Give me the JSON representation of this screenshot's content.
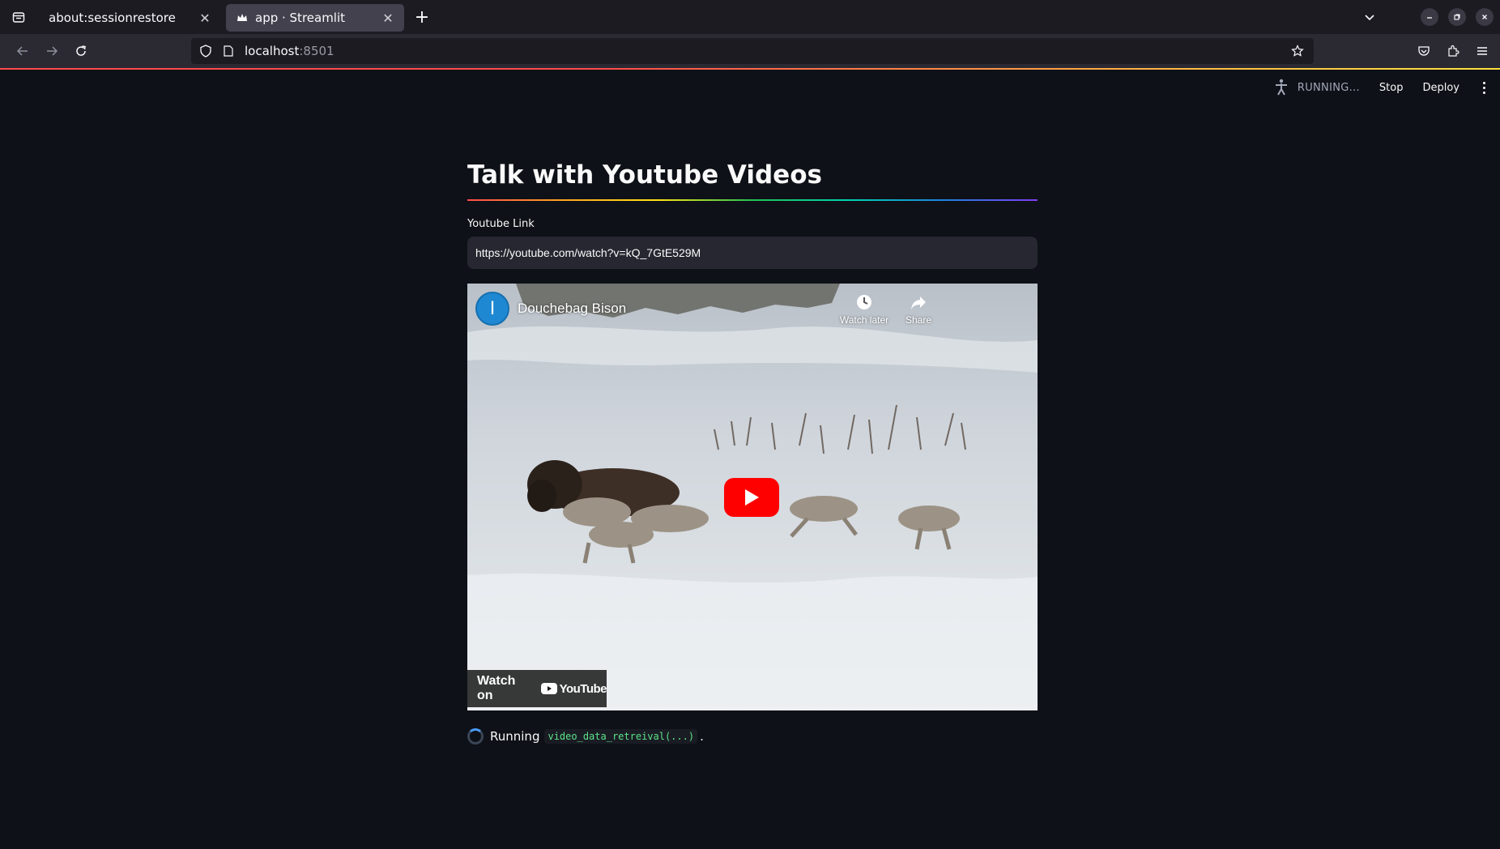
{
  "browser": {
    "tabs": [
      {
        "label": "about:sessionrestore",
        "active": false
      },
      {
        "label": "app · Streamlit",
        "active": true
      }
    ],
    "url_host": "localhost",
    "url_port": ":8501"
  },
  "streamlit_header": {
    "status": "RUNNING...",
    "stop_label": "Stop",
    "deploy_label": "Deploy"
  },
  "main": {
    "title": "Talk with Youtube Videos",
    "input_label": "Youtube Link",
    "input_value": "https://youtube.com/watch?v=kQ_7GtE529M"
  },
  "video": {
    "channel_initial": "I",
    "video_title": "Douchebag Bison",
    "watch_later_label": "Watch later",
    "share_label": "Share",
    "watch_on_label": "Watch on",
    "youtube_wordmark": "YouTube"
  },
  "status": {
    "running_label": "Running",
    "function_name": "video_data_retreival(...)",
    "trailing": "."
  },
  "colors": {
    "page_bg": "#0e1117",
    "input_bg": "#262730",
    "accent_red": "#ff4b4b",
    "spinner": "#4a9cf7",
    "code_green": "#5ce488",
    "youtube_red": "#ff0000"
  }
}
